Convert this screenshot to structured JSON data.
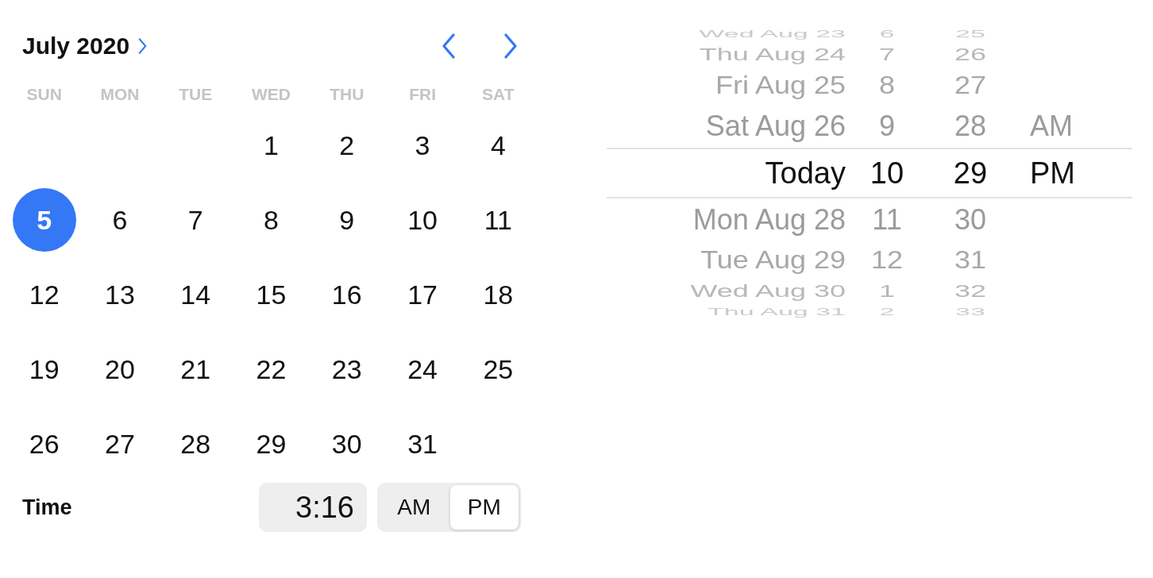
{
  "calendar": {
    "title": "July 2020",
    "weekdays": [
      "SUN",
      "MON",
      "TUE",
      "WED",
      "THU",
      "FRI",
      "SAT"
    ],
    "days": [
      {
        "kind": "blank"
      },
      {
        "kind": "blank"
      },
      {
        "kind": "blank"
      },
      {
        "kind": "day",
        "label": "1",
        "selected": false
      },
      {
        "kind": "day",
        "label": "2",
        "selected": false
      },
      {
        "kind": "day",
        "label": "3",
        "selected": false
      },
      {
        "kind": "day",
        "label": "4",
        "selected": false
      },
      {
        "kind": "day",
        "label": "5",
        "selected": true
      },
      {
        "kind": "day",
        "label": "6",
        "selected": false
      },
      {
        "kind": "day",
        "label": "7",
        "selected": false
      },
      {
        "kind": "day",
        "label": "8",
        "selected": false
      },
      {
        "kind": "day",
        "label": "9",
        "selected": false
      },
      {
        "kind": "day",
        "label": "10",
        "selected": false
      },
      {
        "kind": "day",
        "label": "11",
        "selected": false
      },
      {
        "kind": "day",
        "label": "12",
        "selected": false
      },
      {
        "kind": "day",
        "label": "13",
        "selected": false
      },
      {
        "kind": "day",
        "label": "14",
        "selected": false
      },
      {
        "kind": "day",
        "label": "15",
        "selected": false
      },
      {
        "kind": "day",
        "label": "16",
        "selected": false
      },
      {
        "kind": "day",
        "label": "17",
        "selected": false
      },
      {
        "kind": "day",
        "label": "18",
        "selected": false
      },
      {
        "kind": "day",
        "label": "19",
        "selected": false
      },
      {
        "kind": "day",
        "label": "20",
        "selected": false
      },
      {
        "kind": "day",
        "label": "21",
        "selected": false
      },
      {
        "kind": "day",
        "label": "22",
        "selected": false
      },
      {
        "kind": "day",
        "label": "23",
        "selected": false
      },
      {
        "kind": "day",
        "label": "24",
        "selected": false
      },
      {
        "kind": "day",
        "label": "25",
        "selected": false
      },
      {
        "kind": "day",
        "label": "26",
        "selected": false
      },
      {
        "kind": "day",
        "label": "27",
        "selected": false
      },
      {
        "kind": "day",
        "label": "28",
        "selected": false
      },
      {
        "kind": "day",
        "label": "29",
        "selected": false
      },
      {
        "kind": "day",
        "label": "30",
        "selected": false
      },
      {
        "kind": "day",
        "label": "31",
        "selected": false
      }
    ]
  },
  "time": {
    "label": "Time",
    "value": "3:16",
    "periods": [
      {
        "label": "AM",
        "selected": false
      },
      {
        "label": "PM",
        "selected": true
      }
    ]
  },
  "picker": {
    "date_wheel": [
      {
        "label": "Wed Aug 23",
        "selected": false
      },
      {
        "label": "Thu Aug 24",
        "selected": false
      },
      {
        "label": "Fri Aug 25",
        "selected": false
      },
      {
        "label": "Sat Aug 26",
        "selected": false
      },
      {
        "label": "Today",
        "selected": true
      },
      {
        "label": "Mon Aug 28",
        "selected": false
      },
      {
        "label": "Tue Aug 29",
        "selected": false
      },
      {
        "label": "Wed Aug 30",
        "selected": false
      },
      {
        "label": "Thu Aug 31",
        "selected": false
      }
    ],
    "hour_wheel": [
      {
        "label": "6",
        "selected": false
      },
      {
        "label": "7",
        "selected": false
      },
      {
        "label": "8",
        "selected": false
      },
      {
        "label": "9",
        "selected": false
      },
      {
        "label": "10",
        "selected": true
      },
      {
        "label": "11",
        "selected": false
      },
      {
        "label": "12",
        "selected": false
      },
      {
        "label": "1",
        "selected": false
      },
      {
        "label": "2",
        "selected": false
      }
    ],
    "minute_wheel": [
      {
        "label": "25",
        "selected": false
      },
      {
        "label": "26",
        "selected": false
      },
      {
        "label": "27",
        "selected": false
      },
      {
        "label": "28",
        "selected": false
      },
      {
        "label": "29",
        "selected": true
      },
      {
        "label": "30",
        "selected": false
      },
      {
        "label": "31",
        "selected": false
      },
      {
        "label": "32",
        "selected": false
      },
      {
        "label": "33",
        "selected": false
      }
    ],
    "period_wheel": [
      {
        "label": "AM",
        "selected": false
      },
      {
        "label": "PM",
        "selected": true
      }
    ]
  }
}
